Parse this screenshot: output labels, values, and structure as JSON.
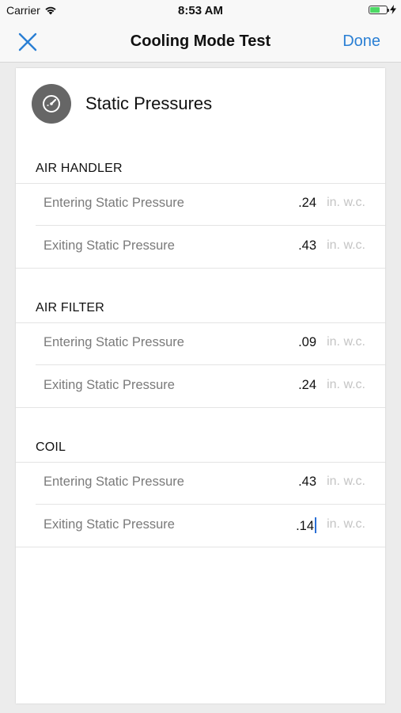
{
  "status_bar": {
    "carrier": "Carrier",
    "time": "8:53 AM",
    "battery_level": 0.6
  },
  "nav": {
    "title": "Cooling Mode Test",
    "done_label": "Done"
  },
  "card": {
    "title": "Static Pressures",
    "icon": "gauge-icon"
  },
  "sections": [
    {
      "title": "AIR HANDLER",
      "rows": [
        {
          "label": "Entering Static Pressure",
          "value": ".24",
          "unit": "in. w.c."
        },
        {
          "label": "Exiting Static Pressure",
          "value": ".43",
          "unit": "in. w.c."
        }
      ]
    },
    {
      "title": "AIR FILTER",
      "rows": [
        {
          "label": "Entering Static Pressure",
          "value": ".09",
          "unit": "in. w.c."
        },
        {
          "label": "Exiting Static Pressure",
          "value": ".24",
          "unit": "in. w.c."
        }
      ]
    },
    {
      "title": "COIL",
      "rows": [
        {
          "label": "Entering Static Pressure",
          "value": ".43",
          "unit": "in. w.c."
        },
        {
          "label": "Exiting Static Pressure",
          "value": ".14",
          "unit": "in. w.c."
        }
      ]
    }
  ],
  "colors": {
    "accent": "#2a7fd4",
    "battery": "#4cd964",
    "unit_text": "#c4c4c4"
  }
}
